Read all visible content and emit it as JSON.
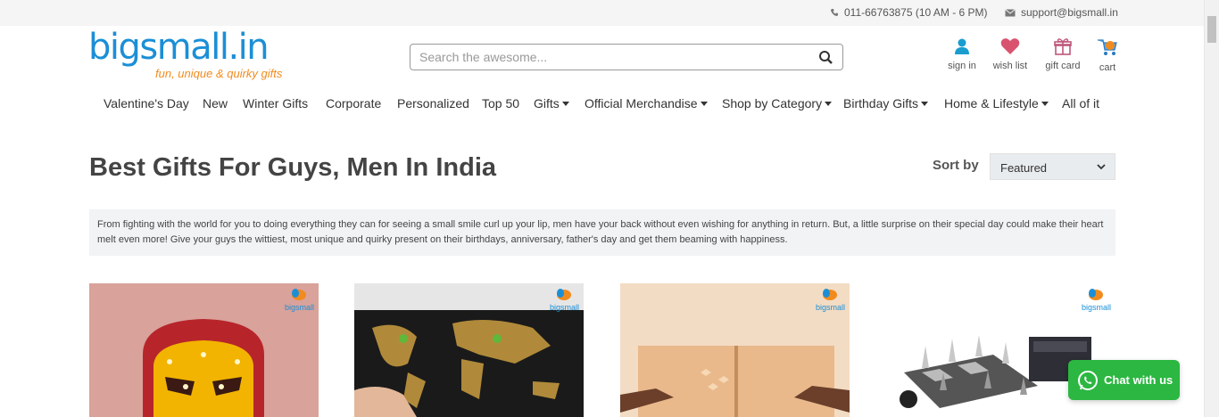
{
  "topbar": {
    "phone": "011-66763875 (10 AM - 6 PM)",
    "email": "support@bigsmall.in"
  },
  "logo": {
    "name": "bigsmall.in",
    "tagline": "fun, unique & quirky gifts"
  },
  "search": {
    "placeholder": "Search the awesome..."
  },
  "user_nav": [
    {
      "label": "sign in",
      "icon": "user-icon"
    },
    {
      "label": "wish list",
      "icon": "heart-icon"
    },
    {
      "label": "gift card",
      "icon": "gift-icon"
    },
    {
      "label": "cart",
      "icon": "cart-icon"
    }
  ],
  "nav": [
    {
      "label": "Valentine's Day"
    },
    {
      "label": "New"
    },
    {
      "label": "Winter Gifts"
    },
    {
      "label": "Corporate"
    },
    {
      "label": "Personalized"
    },
    {
      "label": "Top 50"
    },
    {
      "label": "Gifts",
      "dropdown": true
    },
    {
      "label": "Official Merchandise",
      "dropdown": true
    },
    {
      "label": "Shop by Category",
      "dropdown": true
    },
    {
      "label": "Birthday Gifts",
      "dropdown": true
    },
    {
      "label": "Home & Lifestyle",
      "dropdown": true
    },
    {
      "label": "All of it"
    }
  ],
  "page": {
    "title": "Best Gifts For Guys, Men In India",
    "sort_label": "Sort by",
    "sort_value": "Featured",
    "description": "From fighting with the world for you to doing everything they can for seeing a small smile curl up your lip, men have your back without even wishing for anything in return. But, a little surprise on their special day could make their heart melt even more! Give your guys the wittiest, most unique and quirky present on their birthdays, anniversary, father's day and get them beaming with happiness."
  },
  "products": [
    {
      "name": "iron-man-lamp",
      "brand": "bigsmall"
    },
    {
      "name": "scratch-world-map",
      "brand": "bigsmall"
    },
    {
      "name": "wooden-board-game",
      "brand": "bigsmall"
    },
    {
      "name": "chess-set",
      "brand": "bigsmall"
    }
  ],
  "chat": {
    "label": "Chat with us"
  },
  "colors": {
    "brand_blue": "#1b8fd6",
    "brand_orange": "#f28b1e",
    "user_teal": "#1a9ccf",
    "wishlist_pink": "#d9536f",
    "chat_green": "#2bb741"
  }
}
